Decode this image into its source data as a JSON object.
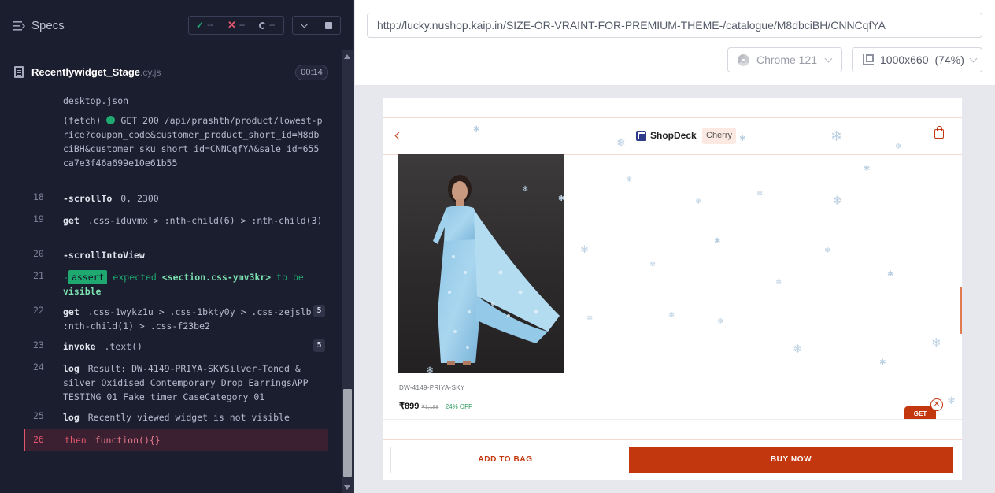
{
  "reporter": {
    "specs_label": "Specs",
    "stats": {
      "passed": "--",
      "failed": "--",
      "pending": "--"
    },
    "spec_file": {
      "name": "Recentlywidget_Stage",
      "ext": ".cy.js",
      "duration": "00:14"
    },
    "commands": [
      {
        "num": "",
        "name": "",
        "message": "desktop.json"
      },
      {
        "num": "",
        "name": "(fetch)",
        "message": "GET 200 /api/prashth/product/lowest-price?coupon_code&customer_product_short_id=M8dbciBH&customer_sku_short_id=CNNCqfYA&sale_id=655ca7e3f46a699e10e61b55"
      },
      {
        "num": "18",
        "name": "-scrollTo",
        "message": "0, 2300"
      },
      {
        "num": "19",
        "name": "get",
        "message": ".css-iduvmx > :nth-child(6) > :nth-child(3)"
      },
      {
        "num": "20",
        "name": "-scrollIntoView",
        "message": ""
      },
      {
        "num": "21",
        "name": "-assert",
        "message_expected": "expected",
        "message_subject": "<section.css-ymv3kr>",
        "message_to_be": "to be",
        "message_visible": "visible"
      },
      {
        "num": "22",
        "name": "get",
        "message": ".css-1wykz1u > .css-1bkty0y > .css-zejslb > :nth-child(1) > .css-f23be2",
        "badge": "5"
      },
      {
        "num": "23",
        "name": "invoke",
        "message": ".text()",
        "badge": "5"
      },
      {
        "num": "24",
        "name": "log",
        "message": "Result: DW-4149-PRIYA-SKYSilver-Toned & silver Oxidised Contemporary Drop EarringsAPP TESTING 01 Fake timer CaseCategory 01"
      },
      {
        "num": "25",
        "name": "log",
        "message": "Recently viewed widget is not visible"
      },
      {
        "num": "26",
        "name": "then",
        "message": "function(){}"
      }
    ]
  },
  "aut": {
    "url": "http://lucky.nushop.kaip.in/SIZE-OR-VRAINT-FOR-PREMIUM-THEME-/catalogue/M8dbciBH/CNNCqfYA",
    "browser": "Chrome 121",
    "viewport": "1000x660",
    "zoom": "(74%)"
  },
  "store": {
    "logo_text": "ShopDeck",
    "store_name": "Cherry",
    "product": {
      "sku": "DW-4149-PRIYA-SKY",
      "price": "₹899",
      "mrp": "₹1,188",
      "separator": "|",
      "discount": "24% OFF"
    },
    "promo_label": "GET",
    "add_to_bag": "ADD TO BAG",
    "buy_now": "BUY NOW"
  },
  "colors": {
    "brand": "#c2370e",
    "pass": "#1fa971",
    "fail": "#e45770",
    "reporter_bg": "#1b1e2e"
  }
}
